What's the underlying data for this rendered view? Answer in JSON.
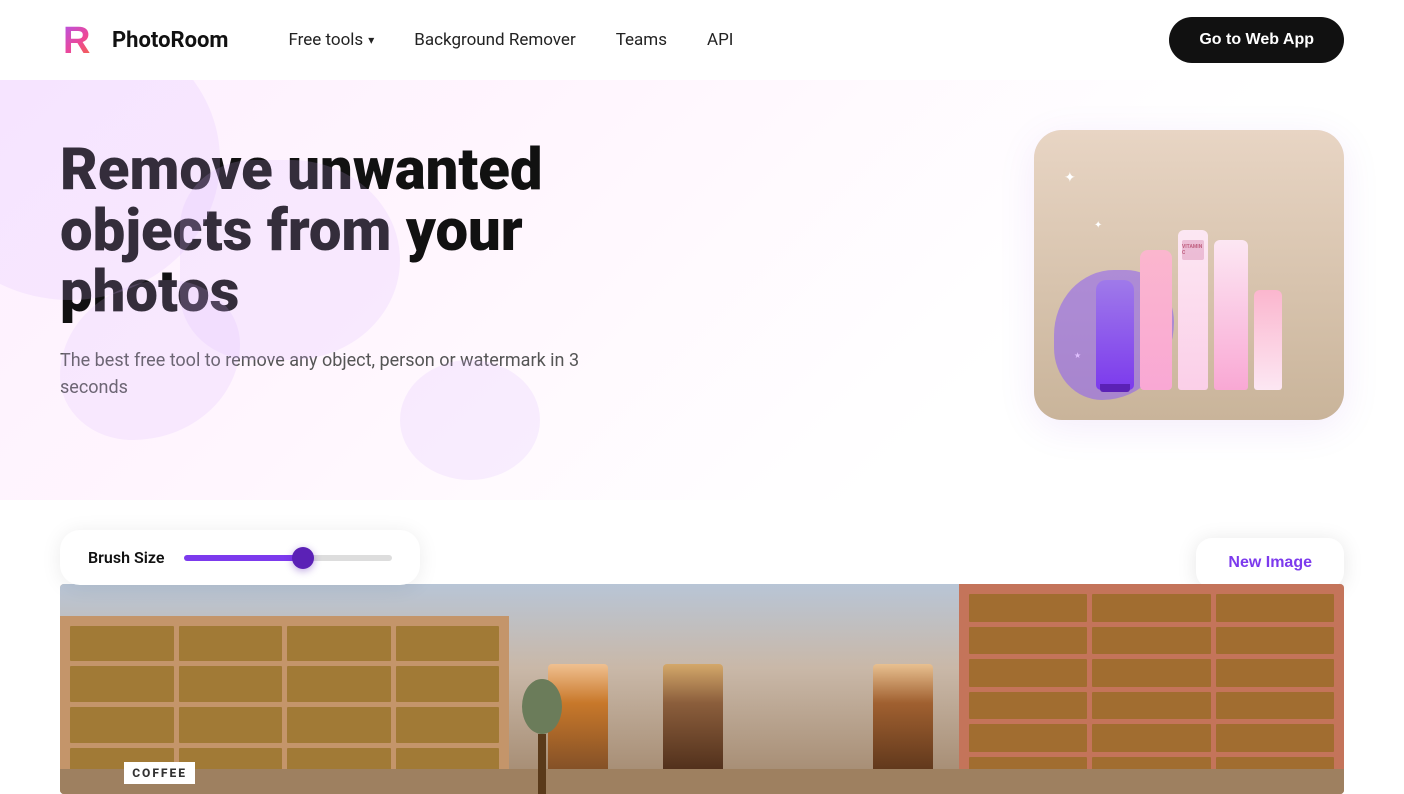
{
  "nav": {
    "logo_text": "PhotoRoom",
    "free_tools_label": "Free tools",
    "background_remover_label": "Background Remover",
    "teams_label": "Teams",
    "api_label": "API",
    "cta_label": "Go to Web App"
  },
  "hero": {
    "title": "Remove unwanted objects from your photos",
    "subtitle": "The best free tool to remove any object, person or watermark in 3 seconds"
  },
  "demo": {
    "brush_size_label": "Brush Size",
    "new_image_label": "New Image"
  },
  "colors": {
    "purple": "#7c3aed",
    "dark_purple": "#5b21b6",
    "text_dark": "#111111",
    "text_mid": "#555555"
  }
}
